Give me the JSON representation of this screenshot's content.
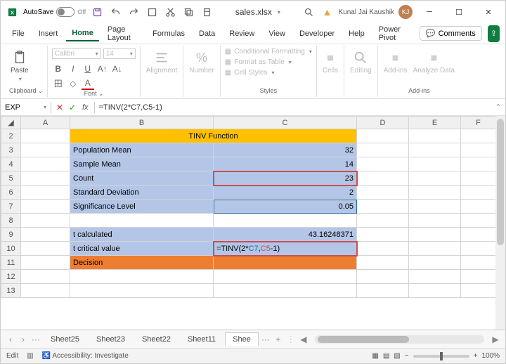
{
  "titlebar": {
    "autosave_label": "AutoSave",
    "autosave_state": "Off",
    "filename": "sales.xlsx",
    "saved_indicator": "",
    "user_name": "Kunal Jai Kaushik",
    "user_initials": "KJ"
  },
  "menu": {
    "file": "File",
    "insert": "Insert",
    "home": "Home",
    "page_layout": "Page Layout",
    "formulas": "Formulas",
    "data": "Data",
    "review": "Review",
    "view": "View",
    "developer": "Developer",
    "help": "Help",
    "power_pivot": "Power Pivot",
    "comments": "Comments"
  },
  "ribbon": {
    "paste": "Paste",
    "clipboard": "Clipboard",
    "font_name": "Calibri",
    "font_size": "14",
    "font": "Font",
    "alignment": "Alignment",
    "number": "Number",
    "cond_formatting": "Conditional Formatting",
    "format_table": "Format as Table",
    "cell_styles": "Cell Styles",
    "styles": "Styles",
    "cells": "Cells",
    "editing": "Editing",
    "add_ins": "Add-ins",
    "analyze": "Analyze Data",
    "addins_group": "Add-ins",
    "pct": "%"
  },
  "namebox": "EXP",
  "formula_bar": "=TINV(2*C7,C5-1)",
  "columns": [
    "A",
    "B",
    "C",
    "D",
    "E",
    "F"
  ],
  "rows": [
    "2",
    "3",
    "4",
    "5",
    "6",
    "7",
    "8",
    "9",
    "10",
    "11",
    "12",
    "13"
  ],
  "cells": {
    "title": "TINV Function",
    "b3": "Population Mean",
    "c3": "32",
    "b4": "Sample Mean",
    "c4": "14",
    "b5": "Count",
    "c5": "23",
    "b6": "Standard Deviation",
    "c6": "2",
    "b7": "Significance Level",
    "c7": "0.05",
    "b9": "t calculated",
    "c9": "43.16248371",
    "b10": "t critical value",
    "c10_pre": "=TINV(2*",
    "c10_ref1": "C7",
    "c10_mid": ",",
    "c10_ref2": "C5",
    "c10_post": "-1)",
    "b11": "Decision"
  },
  "sheets": {
    "s25": "Sheet25",
    "s23": "Sheet23",
    "s22": "Sheet22",
    "s11": "Sheet11",
    "active": "Shee",
    "more": "···"
  },
  "status": {
    "mode": "Edit",
    "accessibility": "Accessibility: Investigate",
    "zoom": "100%"
  }
}
